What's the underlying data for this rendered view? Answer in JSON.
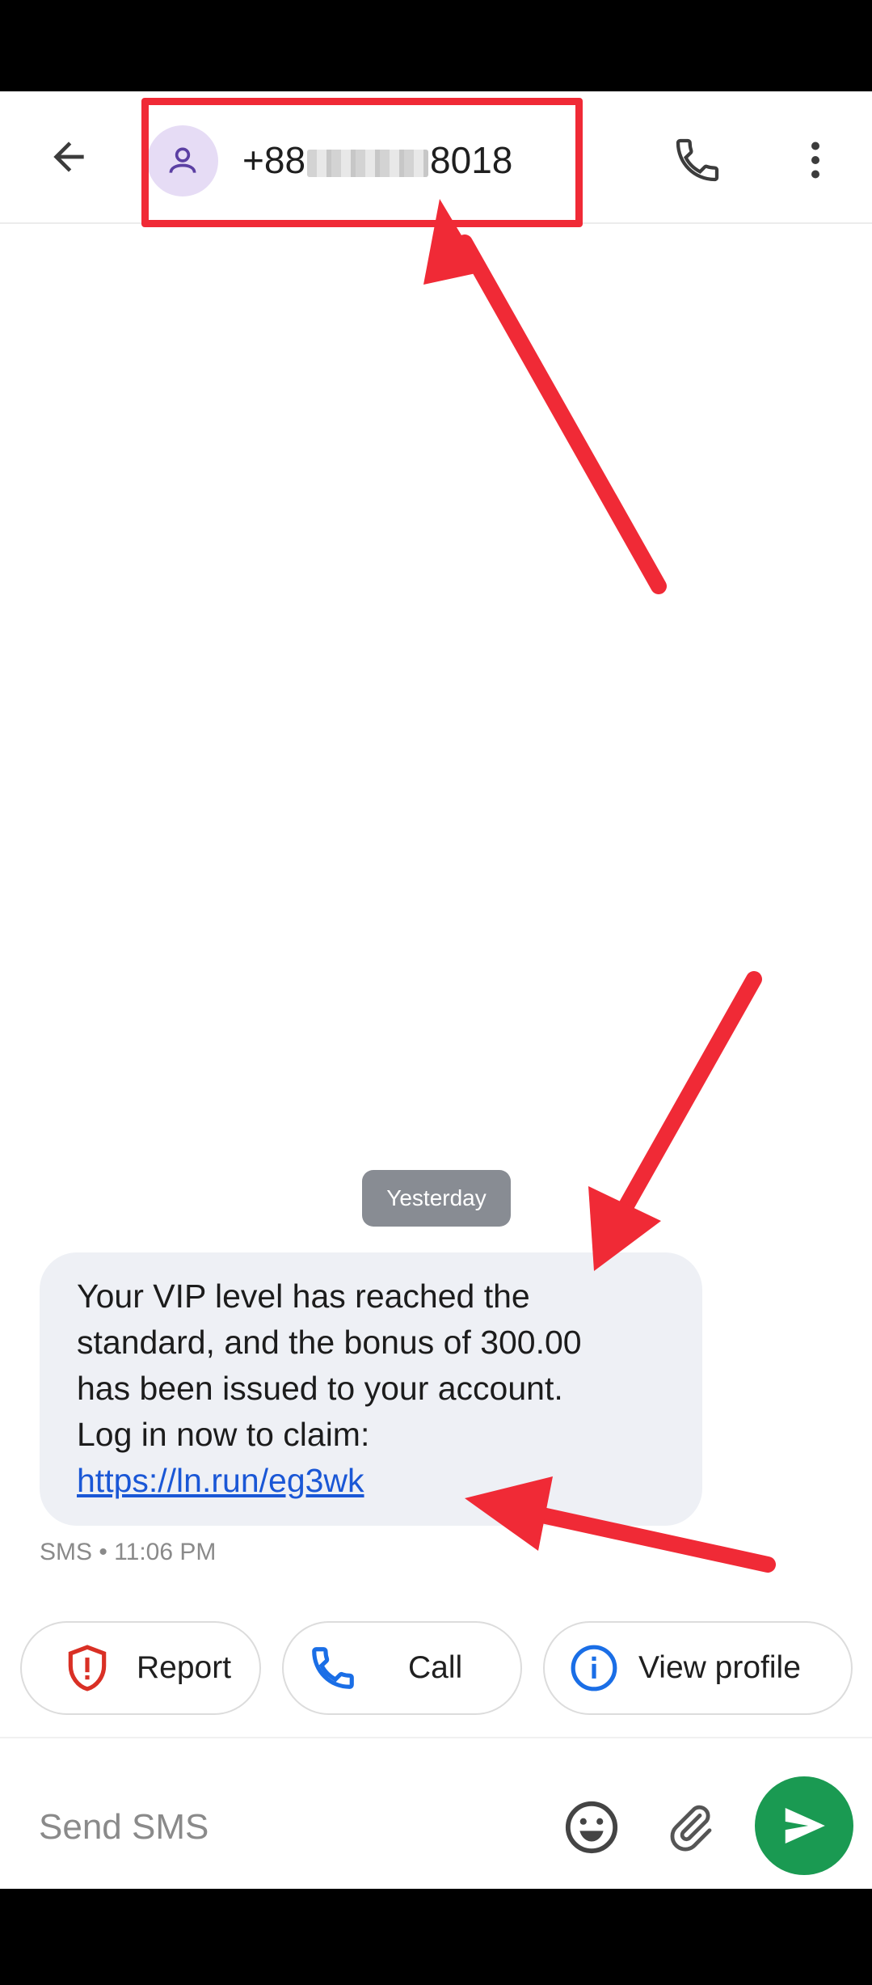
{
  "header": {
    "contact_number_prefix": "+88",
    "contact_number_suffix": "8018",
    "back_icon": "arrow-left-icon",
    "avatar_icon": "person-icon",
    "call_icon": "phone-icon",
    "more_icon": "more-vertical-icon"
  },
  "conversation": {
    "date_label": "Yesterday",
    "messages": [
      {
        "lines": [
          "Your VIP level has reached the",
          "standard, and the bonus of 300.00",
          "has been issued to your account.",
          "Log in now to claim:"
        ],
        "link": "https://ln.run/eg3wk",
        "meta": "SMS • 11:06 PM"
      }
    ]
  },
  "suggestions": {
    "report_label": "Report",
    "call_label": "Call",
    "profile_label": "View profile"
  },
  "composer": {
    "placeholder": "Send SMS"
  },
  "colors": {
    "annotation_red": "#f02a36",
    "send_green": "#1a9a52",
    "link_blue": "#1a57d6",
    "bubble_bg": "#eef0f5"
  }
}
